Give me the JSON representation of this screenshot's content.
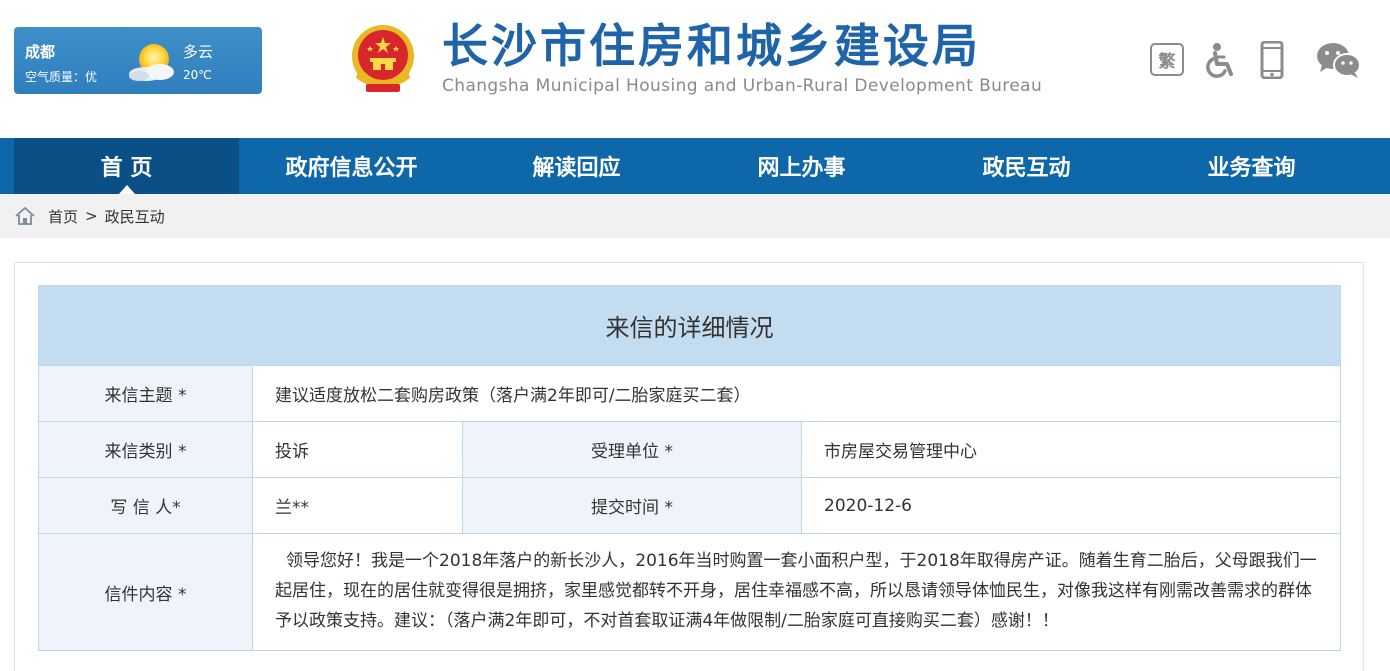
{
  "weather": {
    "city": "成都",
    "air_quality": "空气质量：优",
    "condition": "多云",
    "temperature": "20℃",
    "icon": "partly-cloudy-icon"
  },
  "site": {
    "title_cn": "长沙市住房和城乡建设局",
    "title_en": "Changsha Municipal Housing and Urban-Rural Development Bureau",
    "emblem_icon": "national-emblem-icon"
  },
  "tools": {
    "traditional_label": "繁",
    "accessibility_icon": "wheelchair-icon",
    "mobile_icon": "mobile-phone-icon",
    "wechat_icon": "wechat-icon"
  },
  "nav": {
    "items": [
      {
        "label": "首 页"
      },
      {
        "label": "政府信息公开"
      },
      {
        "label": "解读回应"
      },
      {
        "label": "网上办事"
      },
      {
        "label": "政民互动"
      },
      {
        "label": "业务查询"
      }
    ]
  },
  "breadcrumb": {
    "home": "首页",
    "separator": ">",
    "current": "政民互动"
  },
  "letter": {
    "caption": "来信的详细情况",
    "subject_label": "来信主题 *",
    "subject": "建议适度放松二套购房政策（落户满2年即可/二胎家庭买二套）",
    "type_label": "来信类别 *",
    "type": "投诉",
    "unit_label": "受理单位 *",
    "unit": "市房屋交易管理中心",
    "writer_label": "写 信 人*",
    "writer": "兰**",
    "time_label": "提交时间 *",
    "time": "2020-12-6",
    "content_label": "信件内容 *",
    "content": "领导您好！我是一个2018年落户的新长沙人，2016年当时购置一套小面积户型，于2018年取得房产证。随着生育二胎后，父母跟我们一起居住，现在的居住就变得很是拥挤，家里感觉都转不开身，居住幸福感不高，所以恳请领导体恤民生，对像我这样有刚需改善需求的群体予以政策支持。建议：（落户满2年即可，不对首套取证满4年做限制/二胎家庭可直接购买二套）感谢！！"
  },
  "colors": {
    "nav_bg": "#0e67a8",
    "nav_active": "#0a4f86",
    "title_blue": "#1f64a8",
    "caption_bg": "#c3dcf0",
    "label_bg": "#eef4fa"
  }
}
